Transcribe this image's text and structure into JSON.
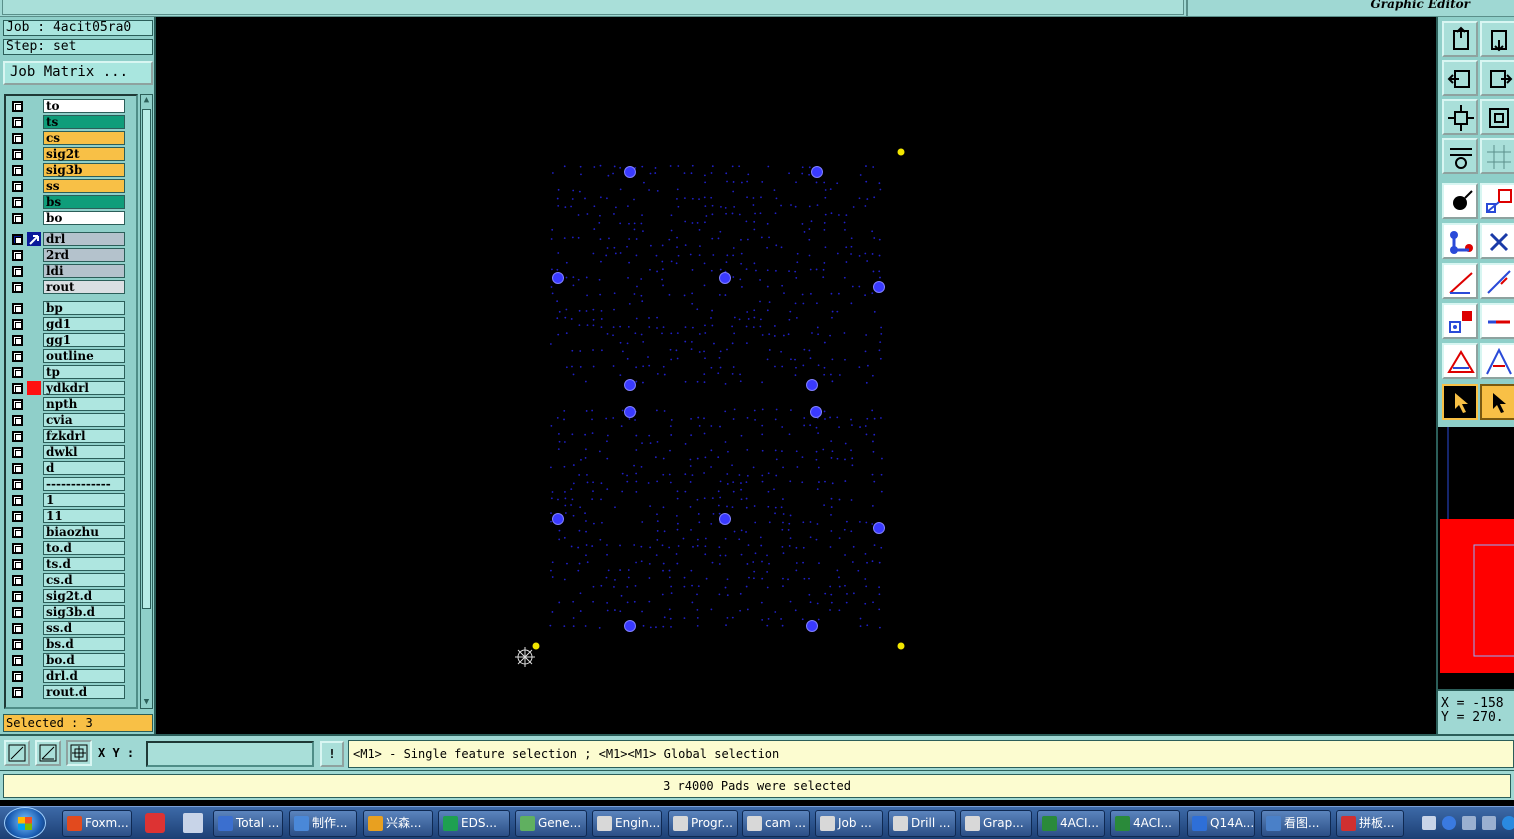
{
  "window": {
    "title": "Graphic Editor"
  },
  "job": {
    "job_label": "Job : 4acit05ra0",
    "step_label": "Step: set",
    "matrix_button": "Job Matrix ..."
  },
  "layers": {
    "board": [
      {
        "name": "to",
        "color": "white"
      },
      {
        "name": "ts",
        "color": "green"
      },
      {
        "name": "cs",
        "color": "orange"
      },
      {
        "name": "sig2t",
        "color": "orange"
      },
      {
        "name": "sig3b",
        "color": "orange"
      },
      {
        "name": "ss",
        "color": "orange"
      },
      {
        "name": "bs",
        "color": "green"
      },
      {
        "name": "bo",
        "color": "white"
      }
    ],
    "drill": [
      {
        "name": "drl",
        "color": "grey",
        "work": true
      },
      {
        "name": "2rd",
        "color": "grey"
      },
      {
        "name": "ldi",
        "color": "grey"
      },
      {
        "name": "rout",
        "color": "lgrey"
      }
    ],
    "misc": [
      {
        "name": "bp",
        "color": "cyan"
      },
      {
        "name": "gd1",
        "color": "cyan"
      },
      {
        "name": "gg1",
        "color": "cyan"
      },
      {
        "name": "outline",
        "color": "cyan"
      },
      {
        "name": "tp",
        "color": "cyan"
      },
      {
        "name": "ydkdrl",
        "color": "cyan",
        "mark": "red"
      },
      {
        "name": "npth",
        "color": "cyan"
      },
      {
        "name": "cvia",
        "color": "cyan"
      },
      {
        "name": "fzkdrl",
        "color": "cyan"
      },
      {
        "name": "dwkl",
        "color": "cyan"
      },
      {
        "name": "d",
        "color": "cyan"
      },
      {
        "name": "-------------",
        "color": "cyan"
      },
      {
        "name": "1",
        "color": "cyan"
      },
      {
        "name": "11",
        "color": "cyan"
      },
      {
        "name": "biaozhu",
        "color": "cyan"
      },
      {
        "name": "to.d",
        "color": "cyan"
      },
      {
        "name": "ts.d",
        "color": "cyan"
      },
      {
        "name": "cs.d",
        "color": "cyan"
      },
      {
        "name": "sig2t.d",
        "color": "cyan"
      },
      {
        "name": "sig3b.d",
        "color": "cyan"
      },
      {
        "name": "ss.d",
        "color": "cyan"
      },
      {
        "name": "bs.d",
        "color": "cyan"
      },
      {
        "name": "bo.d",
        "color": "cyan"
      },
      {
        "name": "drl.d",
        "color": "cyan"
      },
      {
        "name": "rout.d",
        "color": "cyan"
      }
    ]
  },
  "selection": {
    "selected_label": "Selected : 3"
  },
  "coords": {
    "x": "X = -158",
    "y": "Y = 270."
  },
  "command": {
    "xy_label": "X Y :",
    "xy_value": "",
    "bang_label": "!",
    "hint": "<M1> - Single feature selection ; <M1><M1> Global selection"
  },
  "status": {
    "message": "3 r4000 Pads were selected"
  },
  "taskbar": {
    "tasks": [
      {
        "label": "Foxm...",
        "icon_color": "#e24a1e"
      },
      {
        "label": "Total ...",
        "icon_color": "#3b6fcf"
      },
      {
        "label": "制作...",
        "icon_color": "#4a88d8"
      },
      {
        "label": "兴森...",
        "icon_color": "#e8a020"
      },
      {
        "label": "EDS...",
        "icon_color": "#1ea050"
      },
      {
        "label": "Gene...",
        "icon_color": "#60b060"
      },
      {
        "label": "Engin...",
        "icon_color": "#d8d8d8"
      },
      {
        "label": "Progr...",
        "icon_color": "#d8d8d8"
      },
      {
        "label": "cam ...",
        "icon_color": "#d8d8d8"
      },
      {
        "label": "Job ...",
        "icon_color": "#d8d8d8"
      },
      {
        "label": "Drill ...",
        "icon_color": "#d8d8d8"
      },
      {
        "label": "Grap...",
        "icon_color": "#d8d8d8"
      },
      {
        "label": "4ACI...",
        "icon_color": "#2a8a3a"
      },
      {
        "label": "4ACI...",
        "icon_color": "#2a8a3a"
      },
      {
        "label": "Q14A...",
        "icon_color": "#2e6fd8"
      },
      {
        "label": "看图...",
        "icon_color": "#4a80c8"
      },
      {
        "label": "拼板...",
        "icon_color": "#d03030"
      }
    ]
  },
  "colors": {
    "panel": "#8fcfc9",
    "accent_orange": "#f8c046",
    "accent_green": "#0f9d7a",
    "feature_blue": "#2a2adf",
    "pad_yellow": "#f2e600"
  }
}
